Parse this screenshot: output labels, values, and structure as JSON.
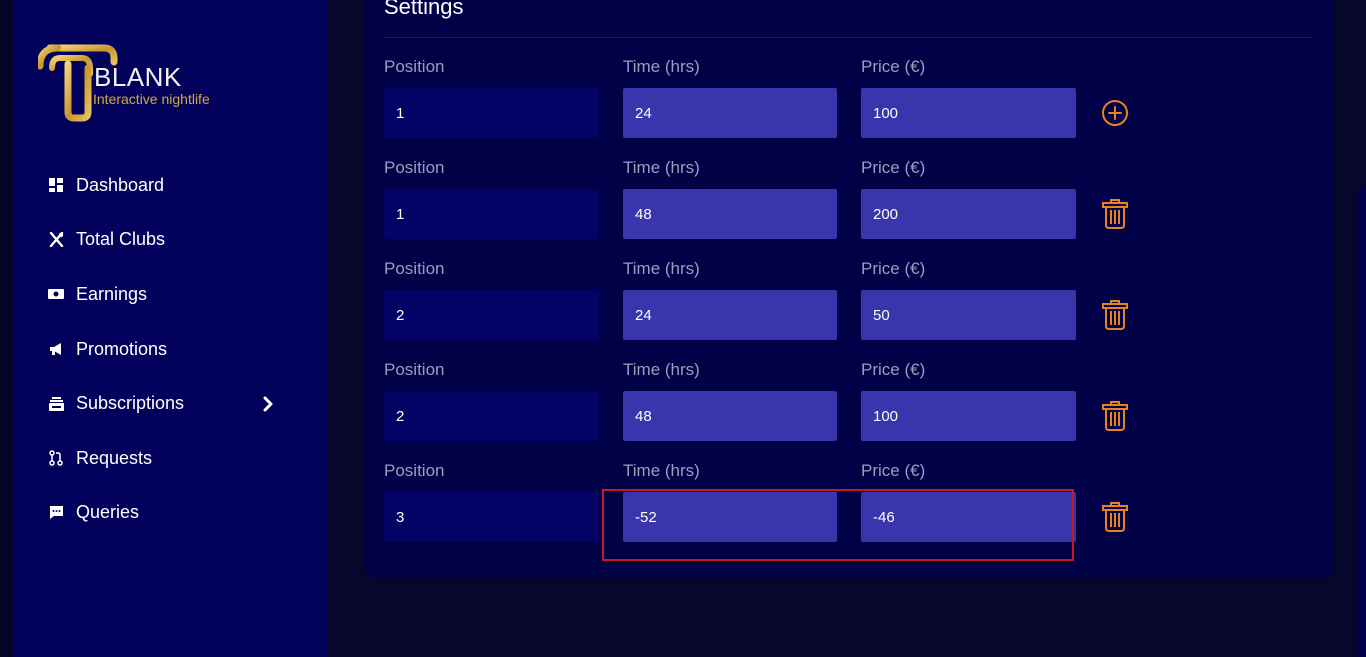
{
  "brand": {
    "name": "BLANK",
    "tagline": "Interactive nightlife",
    "gold": "#d4a83a"
  },
  "sidebar": {
    "items": [
      {
        "label": "Dashboard",
        "icon": "dashboard-icon"
      },
      {
        "label": "Total Clubs",
        "icon": "utensils-icon"
      },
      {
        "label": "Earnings",
        "icon": "money-icon"
      },
      {
        "label": "Promotions",
        "icon": "megaphone-icon"
      },
      {
        "label": "Subscriptions",
        "icon": "subscriptions-icon",
        "expandable": true
      },
      {
        "label": "Requests",
        "icon": "git-pull-request-icon"
      },
      {
        "label": "Queries",
        "icon": "chat-icon"
      }
    ]
  },
  "settings": {
    "title": "Settings",
    "labels": {
      "position": "Position",
      "time": "Time (hrs)",
      "price": "Price (€)"
    },
    "rows": [
      {
        "position": "1",
        "time": "24",
        "price": "100",
        "action": "add"
      },
      {
        "position": "1",
        "time": "48",
        "price": "200",
        "action": "delete"
      },
      {
        "position": "2",
        "time": "24",
        "price": "50",
        "action": "delete"
      },
      {
        "position": "2",
        "time": "48",
        "price": "100",
        "action": "delete"
      },
      {
        "position": "3",
        "time": "-52",
        "price": "-46",
        "action": "delete"
      }
    ]
  },
  "colors": {
    "sidebar_bg": "#02025c",
    "card_bg": "#010148",
    "page_bg": "#07072b",
    "input_active": "#3835ad",
    "input_position": "#030366",
    "action_orange": "#e8821e",
    "highlight_red": "#c01c22"
  }
}
